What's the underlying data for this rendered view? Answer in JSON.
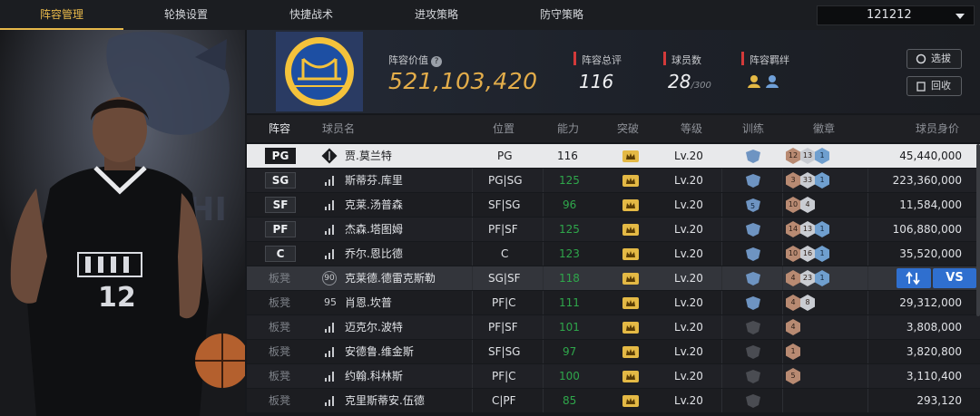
{
  "tabs": [
    {
      "label": "阵容管理",
      "active": true
    },
    {
      "label": "轮换设置",
      "active": false
    },
    {
      "label": "快捷战术",
      "active": false
    },
    {
      "label": "进攻策略",
      "active": false
    },
    {
      "label": "防守策略",
      "active": false
    }
  ],
  "team_select": {
    "value": "121212"
  },
  "summary": {
    "value_label": "阵容价值",
    "value": "521,103,420",
    "overall_label": "阵容总评",
    "overall": "116",
    "count_label": "球员数",
    "count": "28",
    "count_max": "/300",
    "bond_label": "阵容羁绊",
    "pick_label": "选拔",
    "recycle_label": "回收"
  },
  "table": {
    "headers": [
      "阵容",
      "球员名",
      "位置",
      "能力",
      "突破",
      "等级",
      "训练",
      "徽章",
      "球员身价"
    ],
    "rows": [
      {
        "slot": "PG",
        "name": "贾.莫兰特",
        "pos": "PG",
        "ability": "116",
        "level": "Lv.20",
        "badges": [
          "12",
          "13",
          "1"
        ],
        "value": "45,440,000"
      },
      {
        "slot": "SG",
        "name": "斯蒂芬.库里",
        "pos": "PG|SG",
        "ability": "125",
        "level": "Lv.20",
        "badges": [
          "3",
          "33",
          "1"
        ],
        "value": "223,360,000"
      },
      {
        "slot": "SF",
        "name": "克莱.汤普森",
        "pos": "SF|SG",
        "ability": "96",
        "level": "Lv.20",
        "training": "5",
        "badges": [
          "10",
          "4"
        ],
        "value": "11,584,000"
      },
      {
        "slot": "PF",
        "name": "杰森.塔图姆",
        "pos": "PF|SF",
        "ability": "125",
        "level": "Lv.20",
        "badges": [
          "14",
          "13",
          "1"
        ],
        "value": "106,880,000"
      },
      {
        "slot": "C",
        "name": "乔尔.恩比德",
        "pos": "C",
        "ability": "123",
        "level": "Lv.20",
        "badges": [
          "10",
          "16",
          "1"
        ],
        "value": "35,520,000"
      },
      {
        "slot": "板凳",
        "num": "90",
        "name": "克莱德.德雷克斯勒",
        "pos": "SG|SF",
        "ability": "118",
        "level": "Lv.20",
        "badges": [
          "4",
          "23",
          "1"
        ],
        "value": "",
        "swap_label": "VS"
      },
      {
        "slot": "板凳",
        "num": "95",
        "name": "肖恩.坎普",
        "pos": "PF|C",
        "ability": "111",
        "level": "Lv.20",
        "badges": [
          "4",
          "8"
        ],
        "value": "29,312,000"
      },
      {
        "slot": "板凳",
        "name": "迈克尔.波特",
        "pos": "PF|SF",
        "ability": "101",
        "level": "Lv.20",
        "badges": [
          "4"
        ],
        "value": "3,808,000"
      },
      {
        "slot": "板凳",
        "name": "安德鲁.维金斯",
        "pos": "SF|SG",
        "ability": "97",
        "level": "Lv.20",
        "badges": [
          "1"
        ],
        "value": "3,820,800"
      },
      {
        "slot": "板凳",
        "name": "约翰.科林斯",
        "pos": "PF|C",
        "ability": "100",
        "level": "Lv.20",
        "badges": [
          "5"
        ],
        "value": "3,110,400"
      },
      {
        "slot": "板凳",
        "name": "克里斯蒂安.伍德",
        "pos": "C|PF",
        "ability": "85",
        "level": "Lv.20",
        "badges": [],
        "value": "293,120"
      }
    ]
  },
  "player_art": {
    "jersey_number": "12"
  },
  "colors": {
    "accent": "#e7b84a",
    "green": "#2fa74b",
    "blue": "#2f6fcf"
  }
}
